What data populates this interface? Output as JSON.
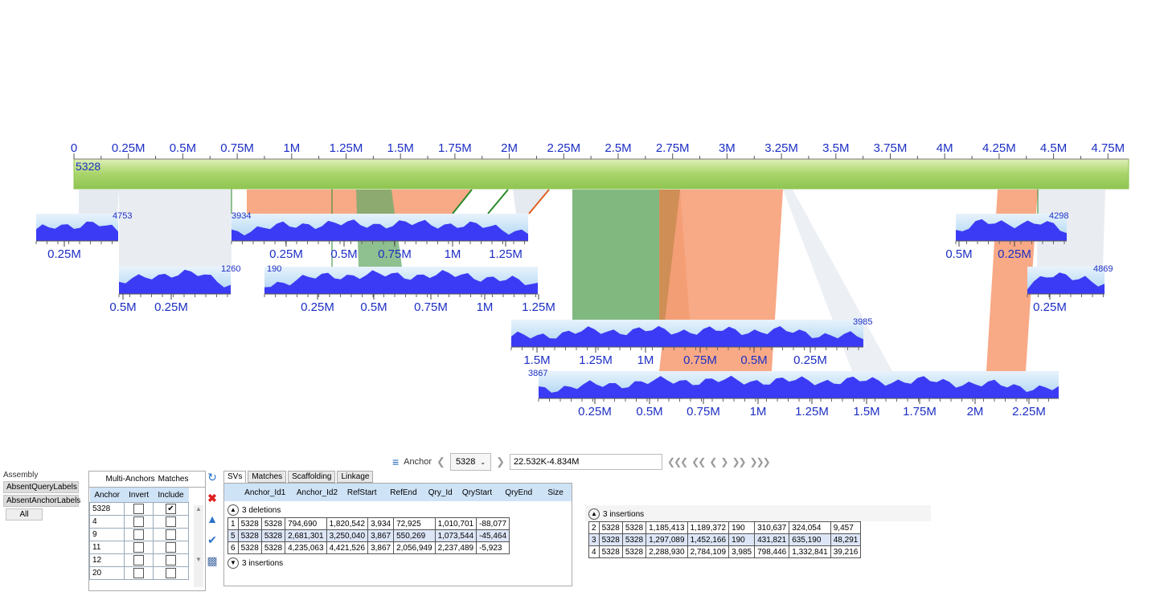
{
  "ref": {
    "id": "5328",
    "ticks": [
      "0",
      "0.25M",
      "0.5M",
      "0.75M",
      "1M",
      "1.25M",
      "1.5M",
      "1.75M",
      "2M",
      "2.25M",
      "2.5M",
      "2.75M",
      "3M",
      "3.25M",
      "3.5M",
      "3.75M",
      "4M",
      "4.25M",
      "4.5M",
      "4.75M"
    ]
  },
  "query_tracks": [
    {
      "id": "4753",
      "ticks": [
        "0.25M"
      ]
    },
    {
      "id": "3934",
      "ticks": [
        "0.25M",
        "0.5M",
        "0.75M",
        "1M",
        "1.25M"
      ]
    },
    {
      "id": "4298",
      "ticks": [
        "0.5M",
        "0.25M"
      ]
    },
    {
      "id": "1260",
      "ticks": [
        "0.5M",
        "0.25M"
      ]
    },
    {
      "id": "190",
      "ticks": [
        "0.25M",
        "0.5M",
        "0.75M",
        "1M",
        "1.25M"
      ]
    },
    {
      "id": "4869",
      "ticks": [
        "0.25M"
      ]
    },
    {
      "id": "3985",
      "ticks": [
        "1.5M",
        "1.25M",
        "1M",
        "0.75M",
        "0.5M",
        "0.25M"
      ]
    },
    {
      "id": "3867",
      "ticks": [
        "0.25M",
        "0.5M",
        "0.75M",
        "1M",
        "1.25M",
        "1.5M",
        "1.75M",
        "2M",
        "2.25M"
      ]
    }
  ],
  "colors": {
    "ref_bar": "#a9d46a",
    "coverage": "#3b3bf5",
    "insertion": "#f7a079",
    "forward": "#6aab6a",
    "neutral": "#dfe5ec"
  },
  "toolbar": {
    "label": "Anchor",
    "anchor_value": "5328",
    "range": "22.532K-4.834M"
  },
  "assembly": {
    "title": "Assembly",
    "buttons": [
      "AbsentQueryLabels",
      "AbsentAnchorLabels"
    ],
    "all_label": "All"
  },
  "multi_anchor": {
    "tabs": [
      "Multi-Anchors",
      "Matches"
    ],
    "columns": [
      "Anchor",
      "Invert",
      "Include"
    ],
    "rows": [
      {
        "anchor": "5328",
        "include": true
      },
      {
        "anchor": "4",
        "include": false
      },
      {
        "anchor": "9",
        "include": false
      },
      {
        "anchor": "11",
        "include": false
      },
      {
        "anchor": "12",
        "include": false
      },
      {
        "anchor": "20",
        "include": false
      }
    ]
  },
  "sv": {
    "tabs": [
      "SVs",
      "Matches",
      "Scaffolding",
      "Linkage"
    ],
    "columns": [
      "Anchor_Id1",
      "Anchor_Id2",
      "RefStart",
      "RefEnd",
      "Qry_Id",
      "QryStart",
      "QryEnd",
      "Size"
    ],
    "deletions_label": "3 deletions",
    "deletions": [
      [
        "1",
        "5328",
        "5328",
        "794,690",
        "1,820,542",
        "3,934",
        "72,925",
        "1,010,701",
        "-88,077"
      ],
      [
        "5",
        "5328",
        "5328",
        "2,681,301",
        "3,250,040",
        "3,867",
        "550,269",
        "1,073,544",
        "-45,464"
      ],
      [
        "6",
        "5328",
        "5328",
        "4,235,063",
        "4,421,526",
        "3,867",
        "2,056,949",
        "2,237,489",
        "-5,923"
      ]
    ],
    "insertions_label": "3 insertions",
    "insertions": [
      [
        "2",
        "5328",
        "5328",
        "1,185,413",
        "1,189,372",
        "190",
        "310,637",
        "324,054",
        "9,457"
      ],
      [
        "3",
        "5328",
        "5328",
        "1,297,089",
        "1,452,166",
        "190",
        "431,821",
        "635,190",
        "48,291"
      ],
      [
        "4",
        "5328",
        "5328",
        "2,288,930",
        "2,784,109",
        "3,985",
        "798,446",
        "1,332,841",
        "39,216"
      ]
    ]
  }
}
